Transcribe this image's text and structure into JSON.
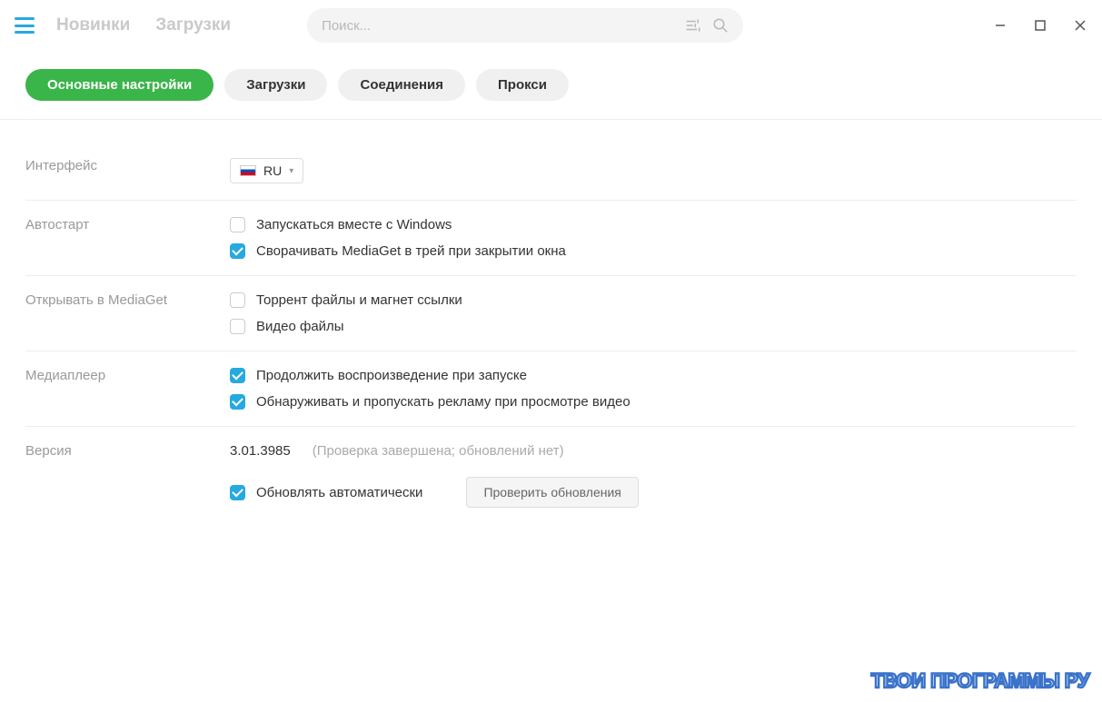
{
  "header": {
    "nav": {
      "new": "Новинки",
      "downloads": "Загрузки"
    },
    "search_placeholder": "Поиск..."
  },
  "tabs": {
    "main": "Основные настройки",
    "downloads": "Загрузки",
    "connections": "Соединения",
    "proxy": "Прокси"
  },
  "settings": {
    "interface": {
      "label": "Интерфейс",
      "lang": "RU"
    },
    "autostart": {
      "label": "Автостарт",
      "run_with_windows": "Запускаться вместе с Windows",
      "minimize_to_tray": "Сворачивать MediaGet в трей при закрытии окна"
    },
    "open_in": {
      "label": "Открывать в MediaGet",
      "torrent": "Торрент файлы и магнет ссылки",
      "video": "Видео файлы"
    },
    "player": {
      "label": "Медиаплеер",
      "resume": "Продолжить воспроизведение при запуске",
      "skip_ads": "Обнаруживать и пропускать рекламу при просмотре видео"
    },
    "version": {
      "label": "Версия",
      "number": "3.01.3985",
      "status": "(Проверка завершена; обновлений нет)",
      "auto_update": "Обновлять автоматически",
      "check_btn": "Проверить обновления"
    }
  },
  "watermark": "ТВОИ ПРОГРАММЫ РУ"
}
